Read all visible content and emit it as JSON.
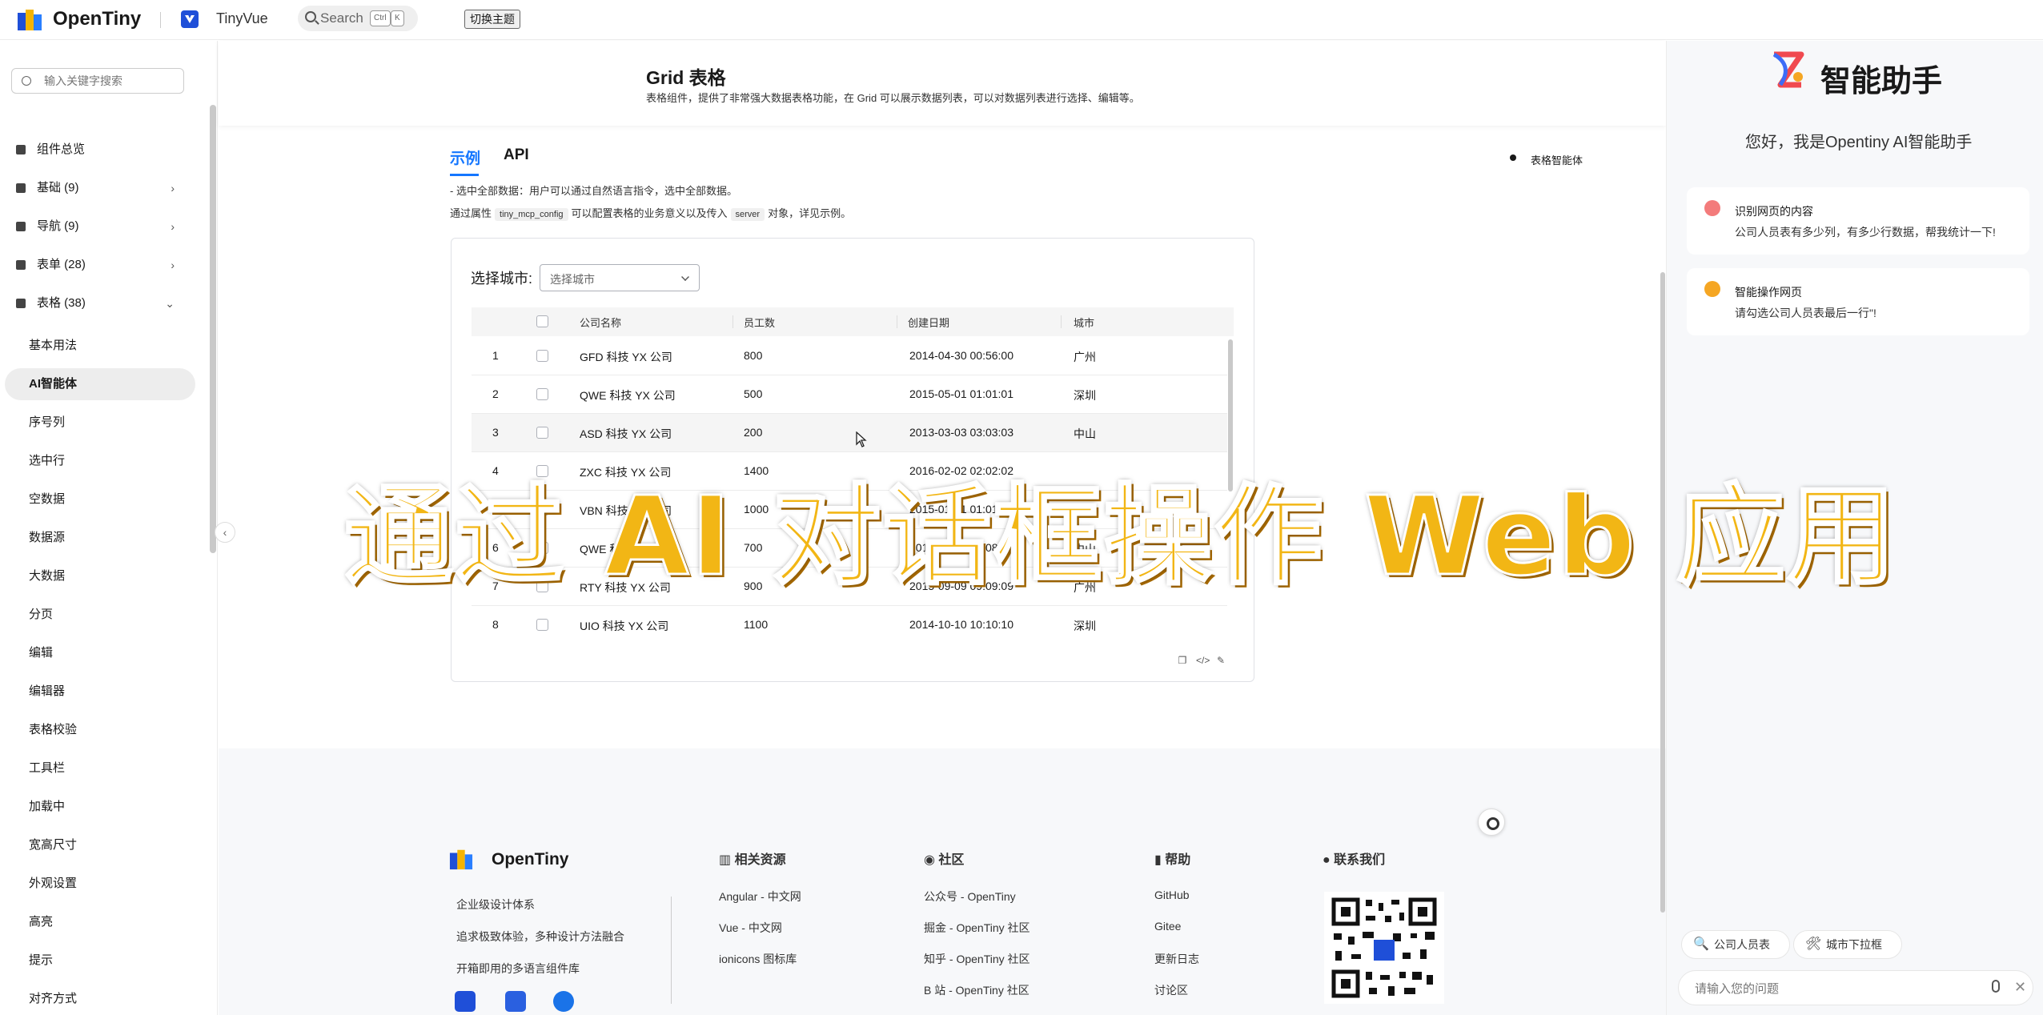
{
  "header": {
    "brand": "OpenTiny",
    "product": "TinyVue",
    "search_label": "Search",
    "search_kbd1": "Ctrl",
    "search_kbd2": "K",
    "theme_button": "切换主题"
  },
  "sidebar": {
    "search_placeholder": "输入关键字搜索",
    "groups": [
      {
        "label": "组件总览"
      },
      {
        "label": "基础 (9)"
      },
      {
        "label": "导航 (9)"
      },
      {
        "label": "表单 (28)"
      },
      {
        "label": "表格 (38)"
      }
    ],
    "items": [
      "基本用法",
      "AI智能体",
      "序号列",
      "选中行",
      "空数据",
      "数据源",
      "大数据",
      "分页",
      "编辑",
      "编辑器",
      "表格校验",
      "工具栏",
      "加载中",
      "宽高尺寸",
      "外观设置",
      "高亮",
      "提示",
      "对齐方式"
    ],
    "active_item": "AI智能体",
    "collapse_icon": "‹"
  },
  "page": {
    "title": "Grid 表格",
    "description": "表格组件，提供了非常强大数据表格功能，在 Grid 可以展示数据列表，可以对数据列表进行选择、编辑等。",
    "tabs": [
      "示例",
      "API"
    ],
    "anchor": "表格智能体",
    "demo_desc_1": "- 选中全部数据：用户可以通过自然语言指令，选中全部数据。",
    "demo_desc_2_a": "通过属性",
    "demo_desc_2_code1": "tiny_mcp_config",
    "demo_desc_2_b": "可以配置表格的业务意义以及传入",
    "demo_desc_2_code2": "server",
    "demo_desc_2_c": "对象，详见示例。"
  },
  "demo": {
    "city_label": "选择城市:",
    "city_placeholder": "选择城市",
    "columns": [
      "公司名称",
      "员工数",
      "创建日期",
      "城市"
    ],
    "rows": [
      {
        "no": "1",
        "name": "GFD 科技 YX 公司",
        "employees": "800",
        "date": "2014-04-30 00:56:00",
        "city": "广州"
      },
      {
        "no": "2",
        "name": "QWE 科技 YX 公司",
        "employees": "500",
        "date": "2015-05-01 01:01:01",
        "city": "深圳"
      },
      {
        "no": "3",
        "name": "ASD 科技 YX 公司",
        "employees": "200",
        "date": "2013-03-03 03:03:03",
        "city": "中山"
      },
      {
        "no": "4",
        "name": "ZXC 科技 YX 公司",
        "employees": "1400",
        "date": "2016-02-02 02:02:02",
        "city": ""
      },
      {
        "no": "5",
        "name": "VBN 科技 YX 公司",
        "employees": "1000",
        "date": "2015-01-01 01:01:01",
        "city": ""
      },
      {
        "no": "6",
        "name": "QWE 科技 YX 公司",
        "employees": "700",
        "date": "2016-08-08 08:08:08",
        "city": "中山"
      },
      {
        "no": "7",
        "name": "RTY 科技 YX 公司",
        "employees": "900",
        "date": "2015-09-09 09:09:09",
        "city": "广州"
      },
      {
        "no": "8",
        "name": "UIO 科技 YX 公司",
        "employees": "1100",
        "date": "2014-10-10 10:10:10",
        "city": "深圳"
      }
    ]
  },
  "overlay_caption": "通过 AI 对话框操作 Web 应用",
  "footer": {
    "brand": "OpenTiny",
    "slogans": [
      "企业级设计体系",
      "追求极致体验，多种设计方法融合",
      "开箱即用的多语言组件库"
    ],
    "columns": [
      {
        "title": "相关资源",
        "links": [
          "Angular - 中文网",
          "Vue - 中文网",
          "ionicons 图标库"
        ]
      },
      {
        "title": "社区",
        "links": [
          "公众号 - OpenTiny",
          "掘金 - OpenTiny 社区",
          "知乎 - OpenTiny 社区",
          "B 站 - OpenTiny 社区"
        ]
      },
      {
        "title": "帮助",
        "links": [
          "GitHub",
          "Gitee",
          "更新日志",
          "讨论区"
        ]
      },
      {
        "title": "联系我们",
        "links": []
      }
    ]
  },
  "assistant": {
    "title": "智能助手",
    "greeting": "您好，我是Opentiny AI智能助手",
    "cards": [
      {
        "title": "识别网页的内容",
        "text": "公司人员表有多少列，有多少行数据，帮我统计一下!",
        "color": "#f37b7b"
      },
      {
        "title": "智能操作网页",
        "text": "请勾选公司人员表最后一行\"!",
        "color": "#f5a623"
      }
    ],
    "chips": [
      {
        "icon": "🔍",
        "label": "公司人员表"
      },
      {
        "icon": "🛠",
        "label": "城市下拉框"
      }
    ],
    "input_placeholder": "请输入您的问题"
  },
  "colors": {
    "accent": "#1476ff",
    "overlay": "#f2b615",
    "active_bg": "#ededed"
  }
}
